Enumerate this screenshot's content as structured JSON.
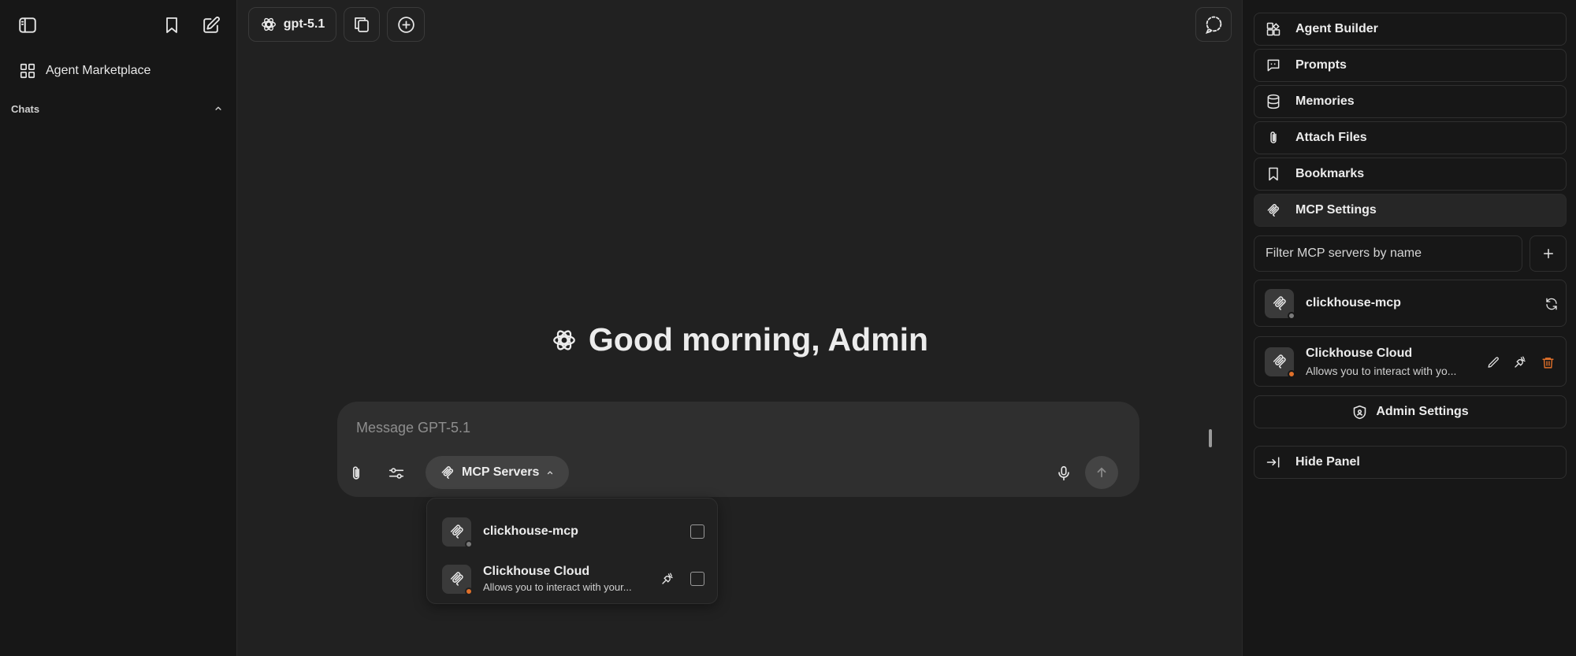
{
  "sidebar": {
    "nav_label": "Agent Marketplace",
    "chats_label": "Chats",
    "icons": [
      "sidebar-toggle-icon",
      "bookmark-icon",
      "new-chat-icon",
      "grid-icon",
      "chevron-up-icon"
    ]
  },
  "header": {
    "model_label": "gpt-5.1",
    "icons": [
      "openai-icon",
      "copy-icon",
      "plus-circle-icon",
      "temporary-chat-icon"
    ]
  },
  "main": {
    "greeting": "Good morning, Admin",
    "composer": {
      "placeholder": "Message GPT-5.1",
      "mcp_button_label": "MCP Servers"
    },
    "mcp_dropdown": [
      {
        "name": "clickhouse-mcp",
        "description": "",
        "status_color": "#7a7a7a",
        "checked": false
      },
      {
        "name": "Clickhouse Cloud",
        "description": "Allows you to interact with your...",
        "status_color": "#e0702a",
        "checked": false
      }
    ]
  },
  "panel": {
    "items": [
      {
        "label": "Agent Builder",
        "icon": "agent-builder-icon"
      },
      {
        "label": "Prompts",
        "icon": "prompts-icon"
      },
      {
        "label": "Memories",
        "icon": "database-icon"
      },
      {
        "label": "Attach Files",
        "icon": "paperclip-icon"
      },
      {
        "label": "Bookmarks",
        "icon": "bookmark-icon"
      },
      {
        "label": "MCP Settings",
        "icon": "mcp-icon"
      }
    ],
    "filter_placeholder": "Filter MCP servers by name",
    "servers": [
      {
        "name": "clickhouse-mcp",
        "description": "",
        "status_color": "#7a7a7a"
      },
      {
        "name": "Clickhouse Cloud",
        "description": "Allows you to interact with yo...",
        "status_color": "#e0702a"
      }
    ],
    "admin_label": "Admin Settings",
    "hide_label": "Hide Panel"
  },
  "colors": {
    "accent_orange": "#e0702a",
    "delete_red": "#e0702a",
    "status_idle": "#7a7a7a"
  }
}
